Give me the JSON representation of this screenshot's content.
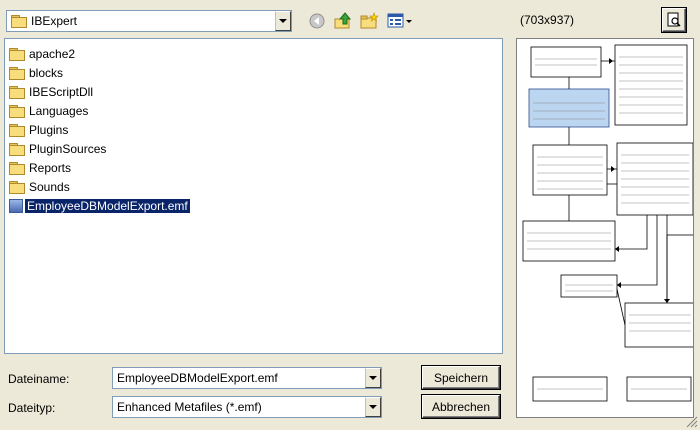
{
  "toolbar": {
    "look_in_value": "IBExpert"
  },
  "files": [
    {
      "name": "apache2",
      "type": "folder"
    },
    {
      "name": "blocks",
      "type": "folder"
    },
    {
      "name": "IBEScriptDll",
      "type": "folder"
    },
    {
      "name": "Languages",
      "type": "folder"
    },
    {
      "name": "Plugins",
      "type": "folder"
    },
    {
      "name": "PluginSources",
      "type": "folder"
    },
    {
      "name": "Reports",
      "type": "folder"
    },
    {
      "name": "Sounds",
      "type": "folder"
    },
    {
      "name": "EmployeeDBModelExport.emf",
      "type": "emf",
      "selected": true
    }
  ],
  "form": {
    "filename_label": "Dateiname:",
    "filename_value": "EmployeeDBModelExport.emf",
    "filetype_label": "Dateityp:",
    "filetype_value": "Enhanced Metafiles (*.emf)",
    "save_label": "Speichern",
    "cancel_label": "Abbrechen"
  },
  "preview": {
    "size_text": "(703x937)"
  },
  "icons": {
    "back": "back-arrow-icon",
    "up": "up-folder-icon",
    "new_folder": "new-folder-icon",
    "view_menu": "view-menu-icon",
    "preview_toggle": "preview-magnifier-icon"
  },
  "colors": {
    "selection": "#0a246a",
    "dialog_bg": "#ece9d8",
    "folder": "#f7dd7c"
  }
}
